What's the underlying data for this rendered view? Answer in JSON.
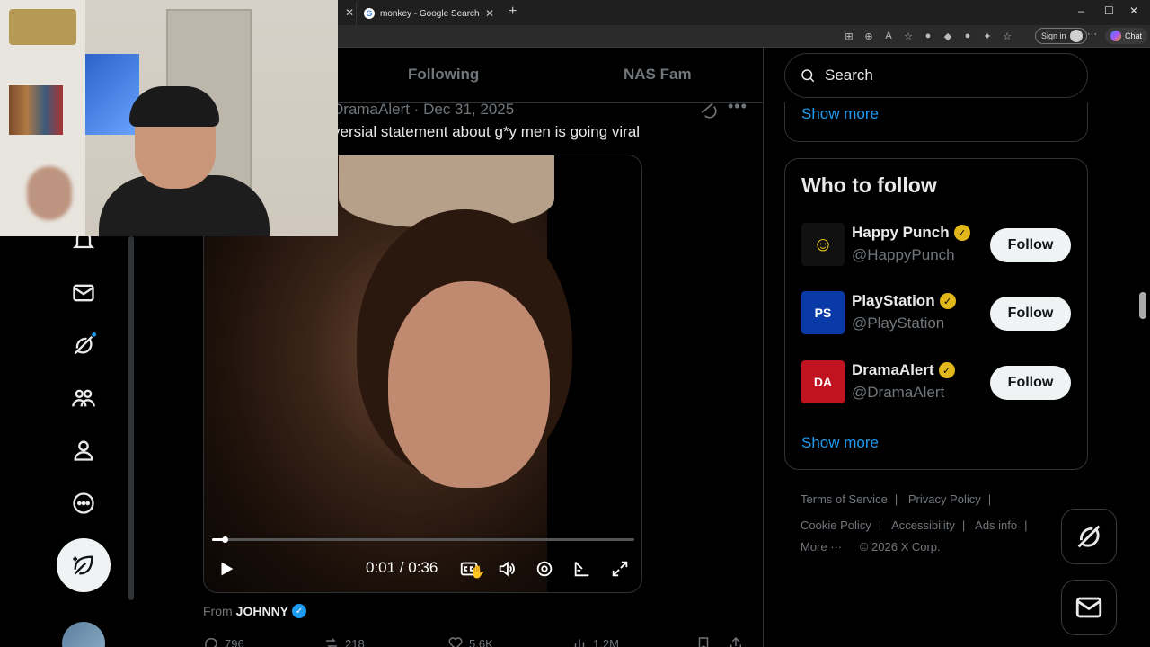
{
  "browser": {
    "tab_title": "monkey - Google Search",
    "tab_favicon_letter": "G",
    "signin_label": "Sign in",
    "chat_label": "Chat",
    "window_controls": [
      "–",
      "☐",
      "✕"
    ]
  },
  "main": {
    "tabs": [
      "Following",
      "NAS Fam"
    ],
    "tweet": {
      "header": "DramaAlert · Dec 31, 2025",
      "text": "versial statement about g*y men is going viral",
      "video": {
        "time": "0:01 / 0:36",
        "progress": 0.03
      },
      "from_label": "From",
      "from_name": "JOHNNY",
      "actions": {
        "replies": "796",
        "reposts": "218",
        "likes": "5.6K",
        "views": "1.2M"
      }
    }
  },
  "sidebar": {
    "search_placeholder": "Search",
    "show_more_top": "Show more",
    "who_to_follow_title": "Who to follow",
    "accounts": [
      {
        "name": "Happy Punch",
        "handle": "@HappyPunch",
        "avatar_glyph": "☺",
        "avatar_bg": "#111111",
        "avatar_fg": "#f5d320"
      },
      {
        "name": "PlayStation",
        "handle": "@PlayStation",
        "avatar_glyph": "PS",
        "avatar_bg": "#0a3aa8",
        "avatar_fg": "#ffffff"
      },
      {
        "name": "DramaAlert",
        "handle": "@DramaAlert",
        "avatar_glyph": "DA",
        "avatar_bg": "#c1121f",
        "avatar_fg": "#ffffff"
      }
    ],
    "follow_label": "Follow",
    "show_more_bottom": "Show more",
    "footer": {
      "links_row1": [
        "Terms of Service",
        "Privacy Policy"
      ],
      "links_row2": [
        "Cookie Policy",
        "Accessibility",
        "Ads info"
      ],
      "more": "More ···",
      "copyright": "© 2026 X Corp."
    }
  },
  "colors": {
    "accent": "#1d9bf0",
    "gold_verified": "#e2b719",
    "background": "#000000",
    "border": "#2f3336"
  }
}
